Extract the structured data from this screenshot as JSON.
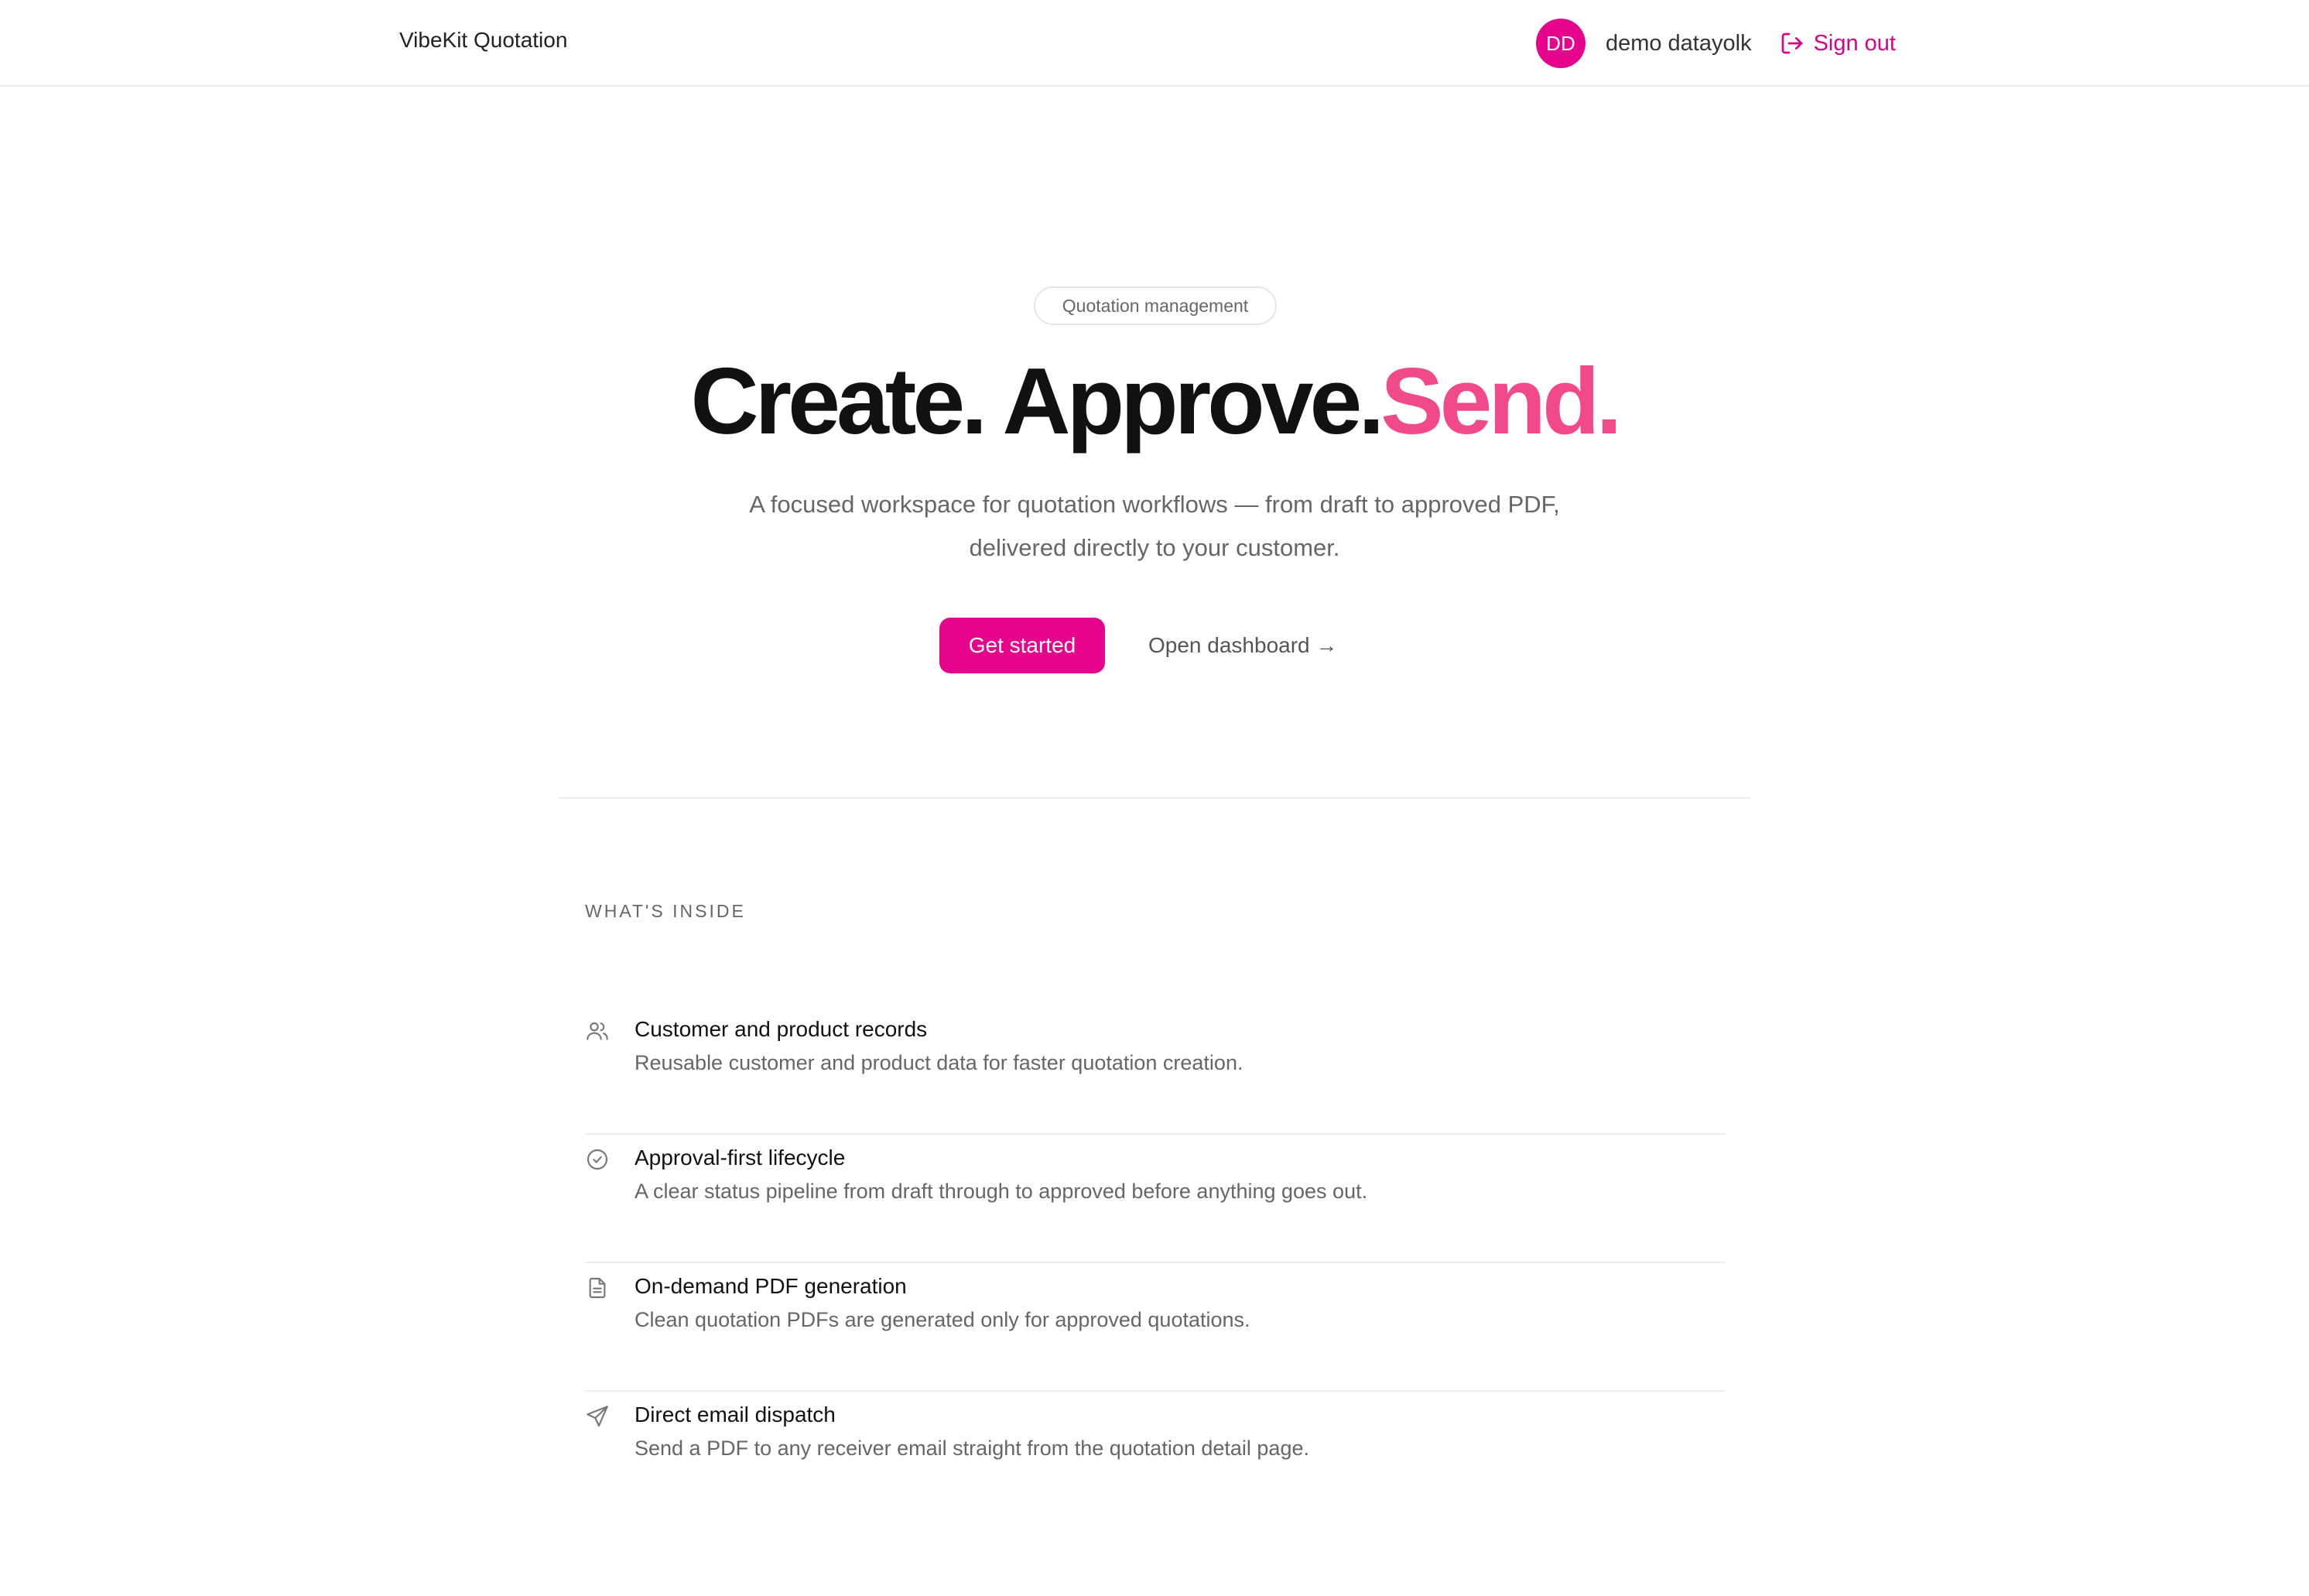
{
  "header": {
    "brand": "VibeKit Quotation",
    "avatar_initials": "DD",
    "username": "demo datayolk",
    "signout_label": "Sign out",
    "signout_icon": "sign-out-icon"
  },
  "hero": {
    "badge": "Quotation management",
    "title_part1": "Create. Approve.",
    "title_accent": "Send.",
    "subtitle_line1": "A focused workspace for quotation workflows — from draft to approved PDF,",
    "subtitle_line2": "delivered directly to your customer.",
    "primary_cta": "Get started",
    "secondary_cta": "Open dashboard →"
  },
  "features": {
    "section_label": "WHAT'S INSIDE",
    "items": [
      {
        "icon": "users-icon",
        "title": "Customer and product records",
        "description": "Reusable customer and product data for faster quotation creation."
      },
      {
        "icon": "check-circle-icon",
        "title": "Approval-first lifecycle",
        "description": "A clear status pipeline from draft through to approved before anything goes out."
      },
      {
        "icon": "document-icon",
        "title": "On-demand PDF generation",
        "description": "Clean quotation PDFs are generated only for approved quotations."
      },
      {
        "icon": "send-icon",
        "title": "Direct email dispatch",
        "description": "Send a PDF to any receiver email straight from the quotation detail page."
      }
    ]
  },
  "colors": {
    "accent": "#e6048c",
    "title_accent": "#f04a8a"
  }
}
